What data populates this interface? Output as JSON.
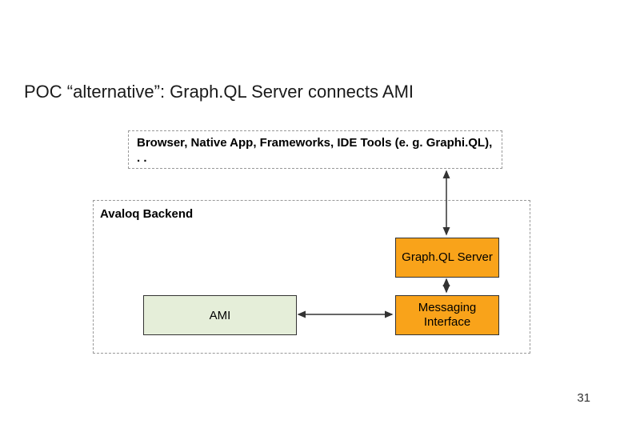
{
  "title": "POC “alternative”: Graph.QL Server connects AMI",
  "clients": "Browser, Native App, Frameworks, IDE Tools (e. g. Graphi.QL), . .",
  "backend_label": "Avaloq Backend",
  "graphql": "Graph.QL Server",
  "messaging": "Messaging Interface",
  "ami": "AMI",
  "page_number": "31"
}
